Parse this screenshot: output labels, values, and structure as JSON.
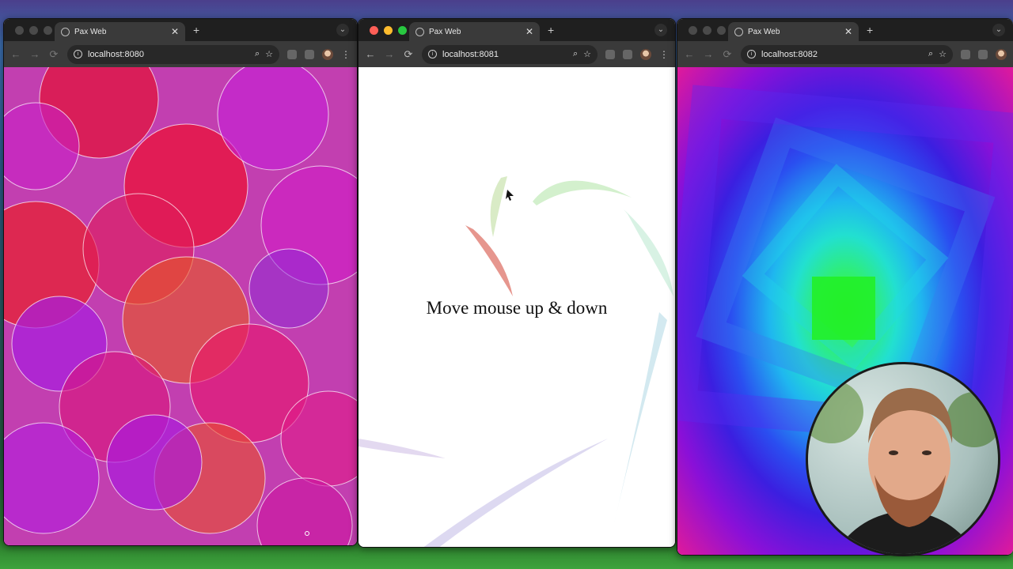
{
  "windows": [
    {
      "tab_title": "Pax Web",
      "url": "localhost:8080"
    },
    {
      "tab_title": "Pax Web",
      "url": "localhost:8081",
      "prompt_text": "Move mouse up & down"
    },
    {
      "tab_title": "Pax Web",
      "url": "localhost:8082"
    }
  ],
  "icons": {
    "close": "✕",
    "new_tab": "+",
    "back": "←",
    "forward": "→",
    "reload": "⟳",
    "zoom": "⌕",
    "star": "☆",
    "menu": "⋮",
    "chevron": "⌄"
  },
  "colors": {
    "close_light": "#ff5f57",
    "min_light": "#febc2e",
    "max_light": "#28c840",
    "circles_bg": "#c23fb0",
    "vortex_center": "#29f52a"
  }
}
